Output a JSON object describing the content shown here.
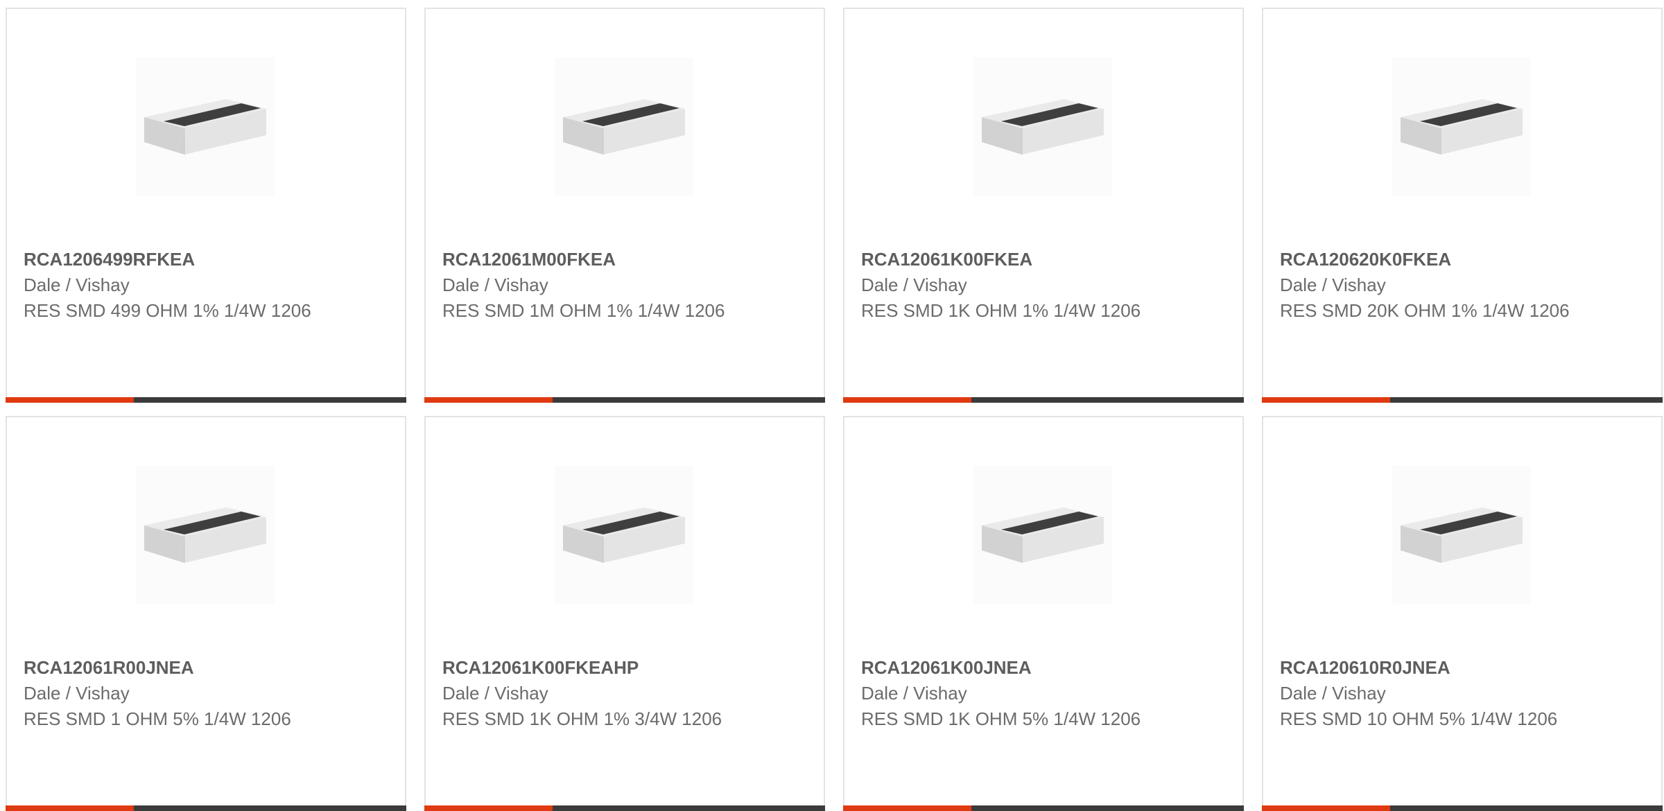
{
  "colors": {
    "accent": "#e03a10",
    "bar": "#3b3b3b",
    "border": "#e3e3e3",
    "text": "#6b6b6b"
  },
  "product_image_icon": "resistor-chip-icon",
  "cards": [
    {
      "part": "RCA1206499RFKEA",
      "manufacturer": "Dale / Vishay",
      "description": "RES SMD 499 OHM 1% 1/4W 1206"
    },
    {
      "part": "RCA12061M00FKEA",
      "manufacturer": "Dale / Vishay",
      "description": "RES SMD 1M OHM 1% 1/4W 1206"
    },
    {
      "part": "RCA12061K00FKEA",
      "manufacturer": "Dale / Vishay",
      "description": "RES SMD 1K OHM 1% 1/4W 1206"
    },
    {
      "part": "RCA120620K0FKEA",
      "manufacturer": "Dale / Vishay",
      "description": "RES SMD 20K OHM 1% 1/4W 1206"
    },
    {
      "part": "RCA12061R00JNEA",
      "manufacturer": "Dale / Vishay",
      "description": "RES SMD 1 OHM 5% 1/4W 1206"
    },
    {
      "part": "RCA12061K00FKEAHP",
      "manufacturer": "Dale / Vishay",
      "description": "RES SMD 1K OHM 1% 3/4W 1206"
    },
    {
      "part": "RCA12061K00JNEA",
      "manufacturer": "Dale / Vishay",
      "description": "RES SMD 1K OHM 5% 1/4W 1206"
    },
    {
      "part": "RCA120610R0JNEA",
      "manufacturer": "Dale / Vishay",
      "description": "RES SMD 10 OHM 5% 1/4W 1206"
    }
  ]
}
